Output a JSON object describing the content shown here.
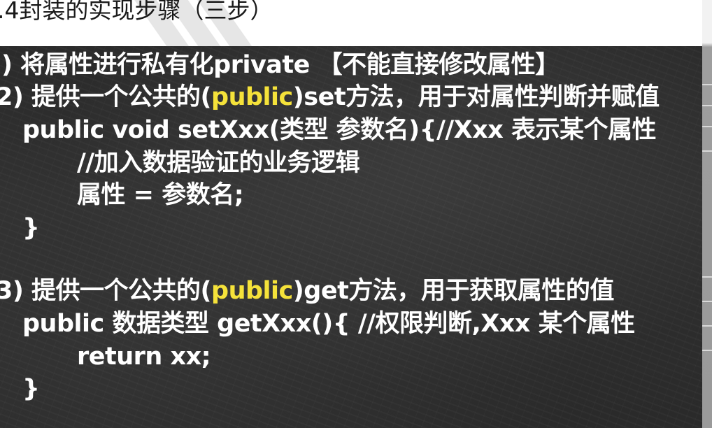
{
  "heading": ".4封装的实现步骤（三步）",
  "steps": [
    {
      "line1_prefix": ") 将属性进行私有化private 【不能直接修改属性】"
    },
    {
      "prefix": "2) 提供一个公共的(",
      "highlight": "public",
      "suffix": ")set方法，用于对属性判断并赋值",
      "code": [
        "public void setXxx(类型 参数名){//Xxx 表示某个属性",
        "//加入数据验证的业务逻辑",
        "属性 = 参数名;",
        "}"
      ]
    },
    {
      "prefix": "3) 提供一个公共的(",
      "highlight": "public",
      "suffix": ")get方法，用于获取属性的值",
      "code": [
        "public 数据类型 getXxx(){ //权限判断,Xxx 某个属性",
        "return xx;",
        "}"
      ]
    }
  ],
  "colors": {
    "board": "#2d2d2d",
    "text": "#ffffff",
    "highlight": "#f5e23a"
  }
}
